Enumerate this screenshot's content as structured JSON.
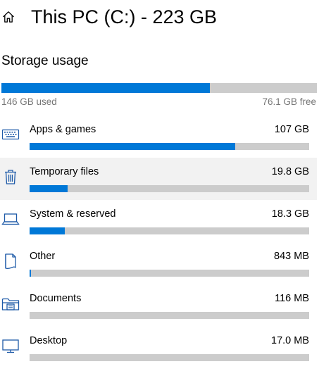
{
  "header": {
    "title": "This PC (C:) - 223 GB",
    "home_icon": "home-icon"
  },
  "storage": {
    "heading": "Storage usage",
    "used_label": "146 GB used",
    "free_label": "76.1 GB free",
    "used_fraction": 0.66
  },
  "colors": {
    "accent": "#0078d7",
    "track": "#cccccc",
    "muted_text": "#767676",
    "hover_row": "#f2f2f2"
  },
  "categories": [
    {
      "label": "Apps & games",
      "size": "107 GB",
      "fill_fraction": 0.735,
      "icon": "keyboard-icon",
      "hovered": false
    },
    {
      "label": "Temporary files",
      "size": "19.8 GB",
      "fill_fraction": 0.137,
      "icon": "trash-icon",
      "hovered": true
    },
    {
      "label": "System & reserved",
      "size": "18.3 GB",
      "fill_fraction": 0.126,
      "icon": "laptop-icon",
      "hovered": false
    },
    {
      "label": "Other",
      "size": "843 MB",
      "fill_fraction": 0.006,
      "icon": "document-icon",
      "hovered": false
    },
    {
      "label": "Documents",
      "size": "116 MB",
      "fill_fraction": 0.0,
      "icon": "folder-icon",
      "hovered": false
    },
    {
      "label": "Desktop",
      "size": "17.0 MB",
      "fill_fraction": 0.0,
      "icon": "monitor-icon",
      "hovered": false
    }
  ]
}
